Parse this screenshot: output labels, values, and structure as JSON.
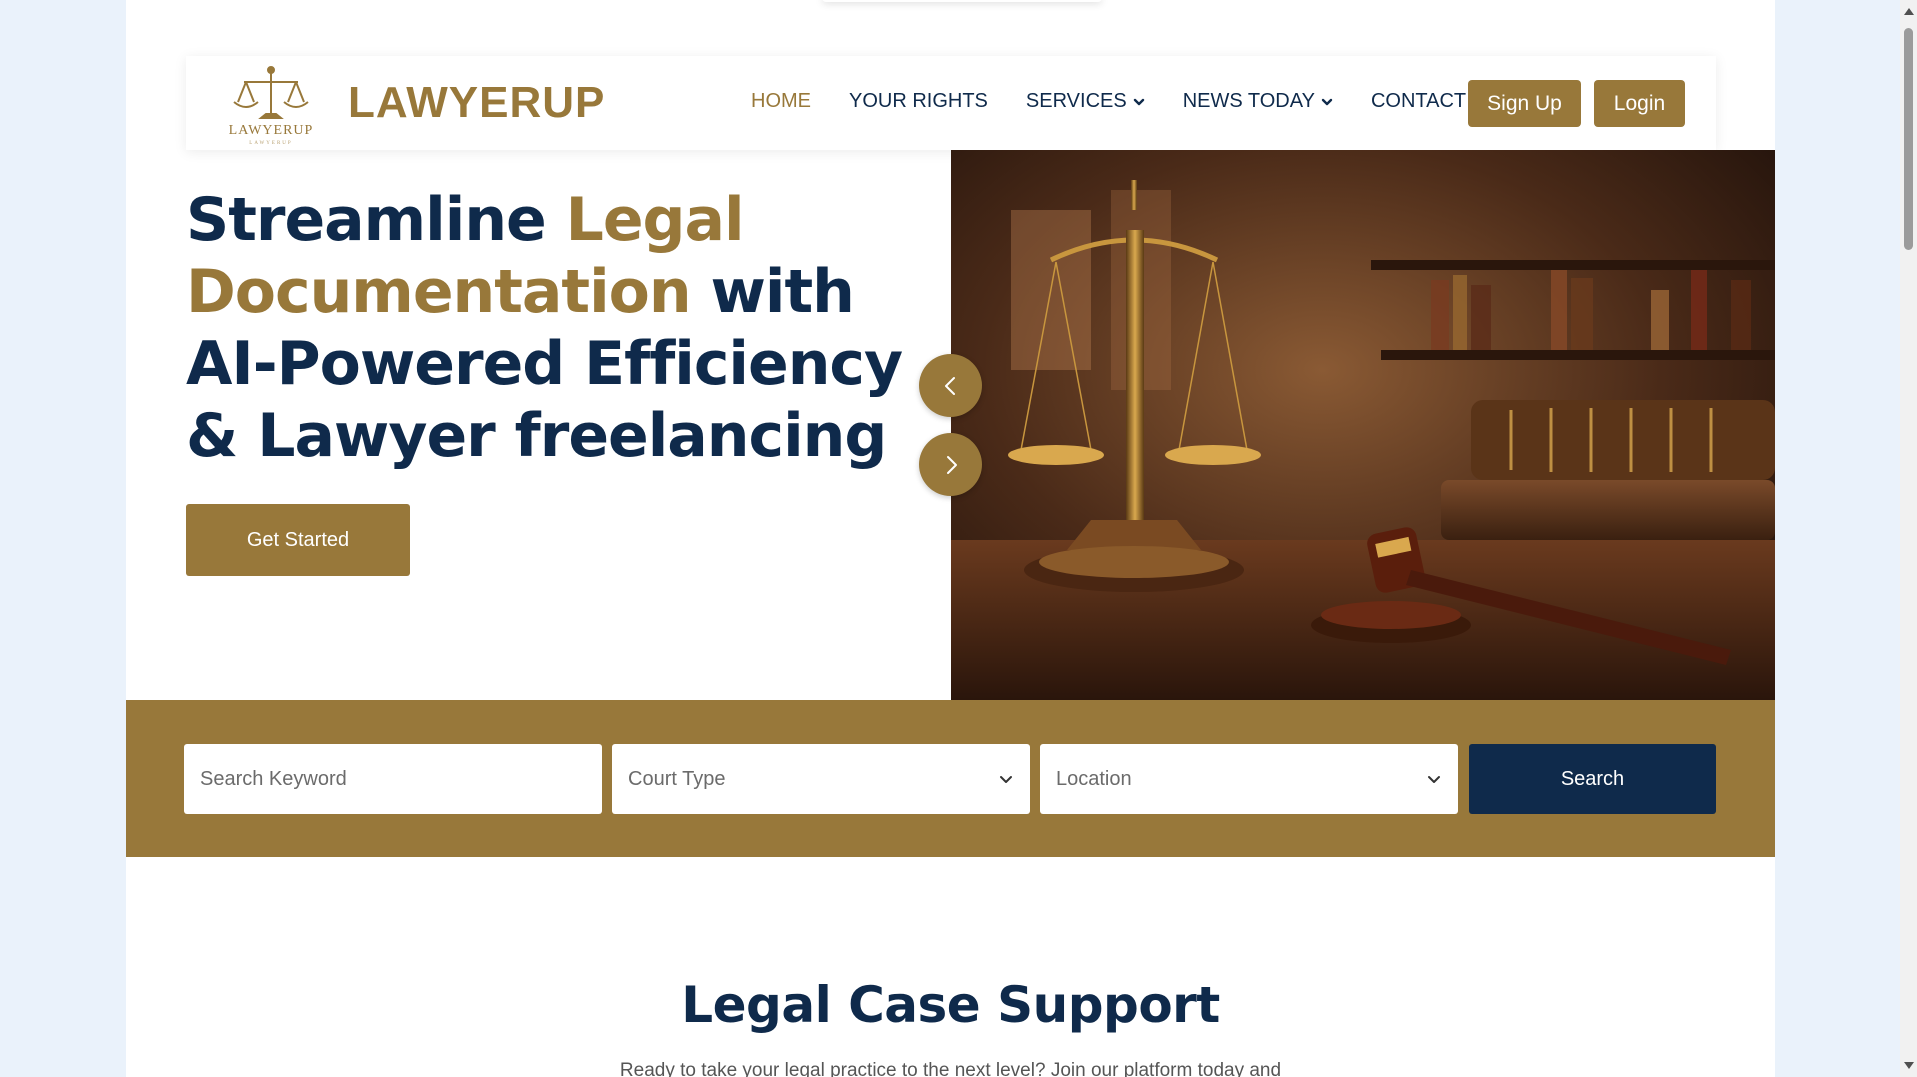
{
  "brand": {
    "name": "LAWYERUP",
    "logo_text": "LAWYERUP",
    "logo_tagline": "LAWYERUP"
  },
  "nav": {
    "items": [
      {
        "label": "HOME",
        "active": true,
        "dropdown": false
      },
      {
        "label": "YOUR RIGHTS",
        "active": false,
        "dropdown": false
      },
      {
        "label": "SERVICES",
        "active": false,
        "dropdown": true
      },
      {
        "label": "NEWS TODAY",
        "active": false,
        "dropdown": true
      },
      {
        "label": "CONTACT",
        "active": false,
        "dropdown": false
      }
    ],
    "signup_label": "Sign Up",
    "login_label": "Login"
  },
  "hero": {
    "title_part1": "Streamline ",
    "title_highlight": "Legal Documentation",
    "title_part2": " with AI-Powered Efficiency & Lawyer freelancing",
    "cta_label": "Get Started",
    "prev_icon": "chevron-left-icon",
    "next_icon": "chevron-right-icon"
  },
  "search": {
    "keyword_placeholder": "Search Keyword",
    "court_type_value": "Court Type",
    "location_value": "Location",
    "button_label": "Search"
  },
  "section": {
    "title": "Legal Case Support",
    "subtitle": "Ready to take your legal practice to the next level? Join our platform today and"
  },
  "colors": {
    "gold": "#98783a",
    "navy": "#0f2a4b",
    "page_bg": "#eaf2fb"
  }
}
